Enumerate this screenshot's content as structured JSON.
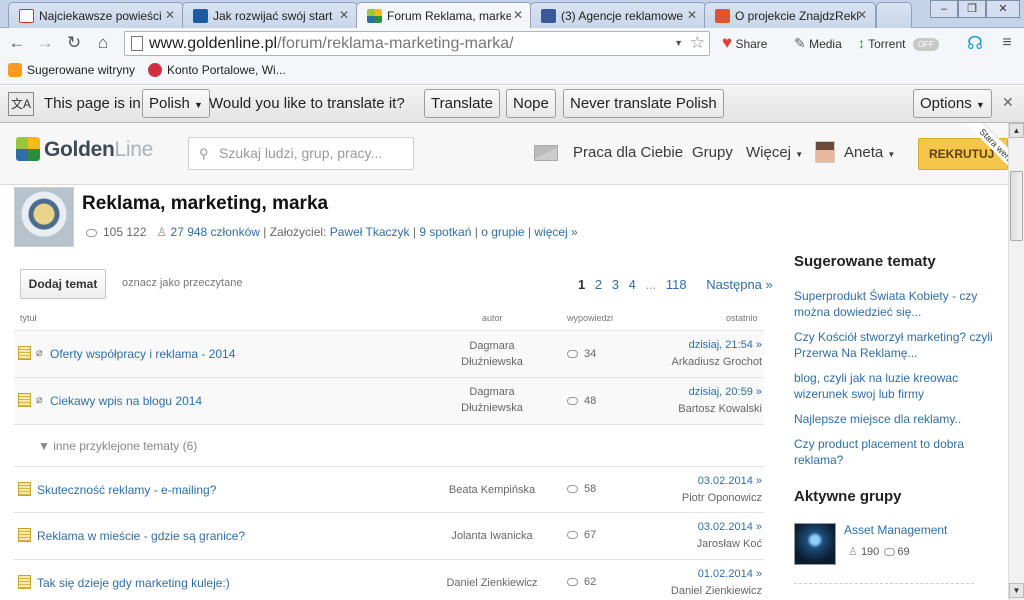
{
  "browser": {
    "tabs": [
      {
        "title": "Najciekawsze powieści",
        "favicon_color": "#d93025"
      },
      {
        "title": "Jak rozwijać swój start",
        "favicon_color": "#1e5aa0"
      },
      {
        "title": "Forum Reklama, marke",
        "favicon_color": "#2a8f3c"
      },
      {
        "title": "(3) Agencje reklamowe",
        "favicon_color": "#3b5998"
      },
      {
        "title": "O projekcie ZnajdzRekl",
        "favicon_color": "#e0542d"
      }
    ],
    "window_controls": [
      "–",
      "❐",
      "✕"
    ],
    "address_host": "www.goldenline.pl",
    "address_path": "/forum/reklama-marketing-marka/",
    "ext_share": "Share",
    "ext_media": "Media",
    "ext_torrent": "Torrent",
    "ext_toggle": "OFF"
  },
  "bookmarks": [
    {
      "label": "Sugerowane witryny"
    },
    {
      "label": "Konto Portalowe, Wi..."
    }
  ],
  "translate": {
    "prefix": "This page is in",
    "language": "Polish",
    "question": "Would you like to translate it?",
    "translate_btn": "Translate",
    "nope_btn": "Nope",
    "never_btn": "Never translate Polish",
    "options_btn": "Options"
  },
  "site": {
    "logo_golden": "Golden",
    "logo_line": "Line",
    "search_placeholder": "Szukaj ludzi, grup, pracy...",
    "nav_work": "Praca dla Ciebie",
    "nav_groups": "Grupy",
    "nav_more": "Więcej",
    "user_name": "Aneta",
    "recruit_btn": "REKRUTUJ",
    "old_version": "Stara wersja"
  },
  "group": {
    "title": "Reklama, marketing, marka",
    "views": "105 122",
    "members": "27 948 członków",
    "founder_label": "Założyciel:",
    "founder": "Paweł Tkaczyk",
    "meetings": "9 spotkań",
    "about": "o grupie",
    "more": "więcej »"
  },
  "forum": {
    "add_topic": "Dodaj temat",
    "mark_read": "oznacz jako przeczytane",
    "pages": [
      "1",
      "2",
      "3",
      "4",
      "...",
      "118"
    ],
    "next": "Następna »",
    "col_title": "tytuł",
    "col_author": "autor",
    "col_replies": "wypowiedzi",
    "col_last": "ostatnio",
    "sticky_toggle": "▼ inne przyklejone tematy (6)",
    "rows": [
      {
        "title": "Oferty współpracy i reklama - 2014",
        "author": "Dagmara Dłużniewska",
        "replies": "34",
        "last_date": "dzisiaj, 21:54 »",
        "last_user": "Arkadiusz Grochot",
        "sticky": true
      },
      {
        "title": "Ciekawy wpis na blogu 2014",
        "author": "Dagmara Dłużniewska",
        "replies": "48",
        "last_date": "dzisiaj, 20:59 »",
        "last_user": "Bartosz Kowalski",
        "sticky": true
      },
      {
        "title": "Skuteczność reklamy - e-mailing?",
        "author": "Beata Kempińska",
        "replies": "58",
        "last_date": "03.02.2014 »",
        "last_user": "Piotr Oponowicz",
        "sticky": false
      },
      {
        "title": "Reklama w mieście - gdzie są granice?",
        "author": "Jolanta Iwanicka",
        "replies": "67",
        "last_date": "03.02.2014 »",
        "last_user": "Jarosław Koć",
        "sticky": false
      },
      {
        "title": "Tak się dzieje gdy marketing kuleje:)",
        "author": "Daniel Zienkiewicz",
        "replies": "62",
        "last_date": "01.02.2014 »",
        "last_user": "Daniel Zienkiewicz",
        "sticky": false
      }
    ]
  },
  "sidebar": {
    "suggested_title": "Sugerowane tematy",
    "suggested": [
      "Superprodukt Świata Kobiety - czy można dowiedzieć się...",
      "Czy Kościół stworzył marketing? czyli Przerwa Na Reklamę...",
      "blog, czyli jak na luzie kreowac wizerunek swoj lub firmy",
      "Najlepsze miejsce dla reklamy..",
      "Czy product placement to dobra reklama?"
    ],
    "active_title": "Aktywne grupy",
    "active_group_name": "Asset Management",
    "active_group_members": "190",
    "active_group_posts": "69"
  }
}
